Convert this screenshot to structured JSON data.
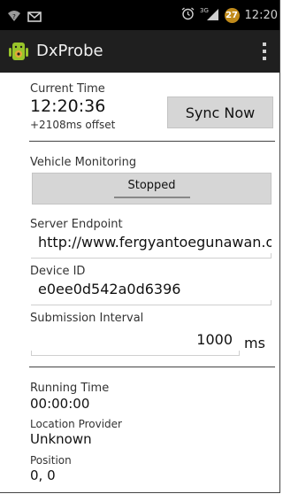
{
  "status_bar": {
    "time": "12:20",
    "badge": "27",
    "network_label": "3G",
    "icons": [
      "wifi-question-icon",
      "mail-icon",
      "alarm-icon",
      "signal-icon"
    ]
  },
  "action_bar": {
    "title": "DxProbe",
    "app_icon": "android-app-icon",
    "overflow_icon": "overflow-menu-icon"
  },
  "current_time": {
    "label": "Current Time",
    "value": "12:20:36",
    "offset": "+2108ms offset"
  },
  "sync_button": {
    "label": "Sync Now"
  },
  "vehicle_monitoring": {
    "label": "Vehicle Monitoring",
    "toggle_label": "Stopped"
  },
  "server_endpoint": {
    "label": "Server Endpoint",
    "value": "http://www.fergyantoegunawan.org/dxprobe"
  },
  "device_id": {
    "label": "Device ID",
    "value": "e0ee0d542a0d6396"
  },
  "submission_interval": {
    "label": "Submission Interval",
    "value": "1000",
    "unit": "ms"
  },
  "running_time": {
    "label": "Running Time",
    "value": "00:00:00"
  },
  "location_provider": {
    "label": "Location Provider",
    "value": "Unknown"
  },
  "position": {
    "label": "Position",
    "value": "0, 0"
  },
  "colors": {
    "status_bar_bg": "#000000",
    "action_bar_bg": "#1f1f1f",
    "button_bg": "#d6d6d6",
    "badge": "#c08a1a"
  }
}
